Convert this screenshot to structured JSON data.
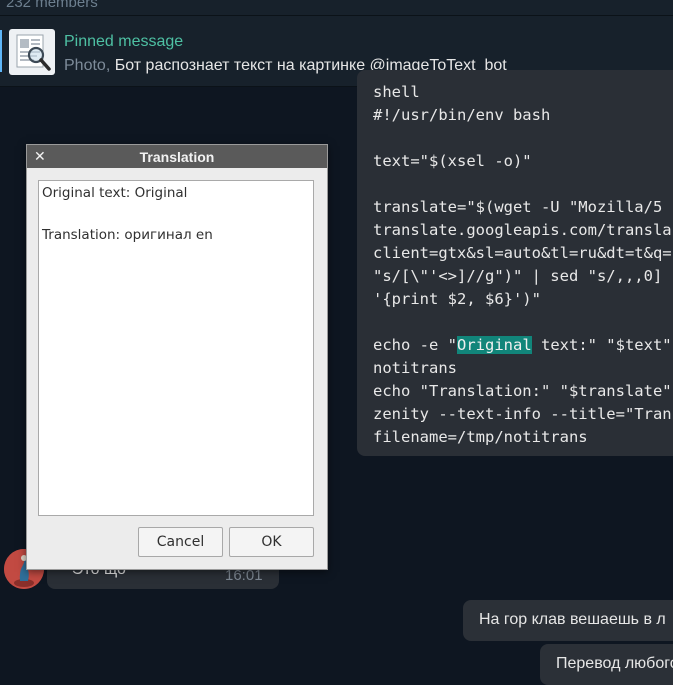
{
  "header": {
    "members": "232 members"
  },
  "pinned": {
    "title": "Pinned message",
    "media_type": "Photo,",
    "text": "Бот распознает текст на картинке  @imageToText_bot"
  },
  "code_message": {
    "lines": [
      "shell",
      "#!/usr/bin/env bash",
      "",
      "text=\"$(xsel -o)\"",
      "",
      "translate=\"$(wget -U \"Mozilla/5",
      "translate.googleapis.com/transla",
      "client=gtx&sl=auto&tl=ru&dt=t&q=",
      "\"s/[\\\"'<>]//g\")\" | sed \"s/,,,0]",
      "'{print $2, $6}')\"",
      "",
      "echo -e \"",
      "notitrans",
      "echo \"Translation:\" \"$translate\"",
      "zenity --text-info --title=\"Tran",
      "filename=/tmp/notitrans"
    ],
    "echo_highlight": "Original",
    "echo_rest": " text:\" \"$text\""
  },
  "incoming_message": {
    "text": "Это що",
    "time": "16:01"
  },
  "outgoing_messages": [
    "На гор клав вешаешь в л",
    "Перевод любого"
  ],
  "dialog": {
    "title": "Translation",
    "close_glyph": "✕",
    "original_line": "Original text: Original",
    "translation_line": "Translation: оригинал en",
    "cancel_label": "Cancel",
    "ok_label": "OK"
  },
  "colors": {
    "background": "#0e1621",
    "panel": "#17212b",
    "bubble": "#2a2f36",
    "accent_green": "#4ec0a3",
    "highlight": "#11857a",
    "dialog_titlebar": "#5a5a5a"
  }
}
